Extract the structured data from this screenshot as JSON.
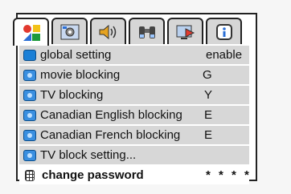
{
  "tabs": [
    {
      "icon": "shapes-icon",
      "active": true
    },
    {
      "icon": "settings-icon",
      "active": false
    },
    {
      "icon": "speaker-icon",
      "active": false
    },
    {
      "icon": "binoculars-icon",
      "active": false
    },
    {
      "icon": "display-icon",
      "active": false
    },
    {
      "icon": "info-icon",
      "active": false
    }
  ],
  "menu": {
    "items": [
      {
        "label": "global setting",
        "value": "enable"
      },
      {
        "label": "movie blocking",
        "value": "G"
      },
      {
        "label": "TV blocking",
        "value": "Y"
      },
      {
        "label": "Canadian English blocking",
        "value": "E"
      },
      {
        "label": "Canadian French blocking",
        "value": "E"
      },
      {
        "label": "TV block setting...",
        "value": ""
      },
      {
        "label": "change password",
        "value": "* * * *"
      }
    ]
  },
  "colors": {
    "row_bg": "#d7d7d7",
    "selected_bg": "#ffffff",
    "icon_blue": "#1a7fd6",
    "frame": "#222222"
  }
}
